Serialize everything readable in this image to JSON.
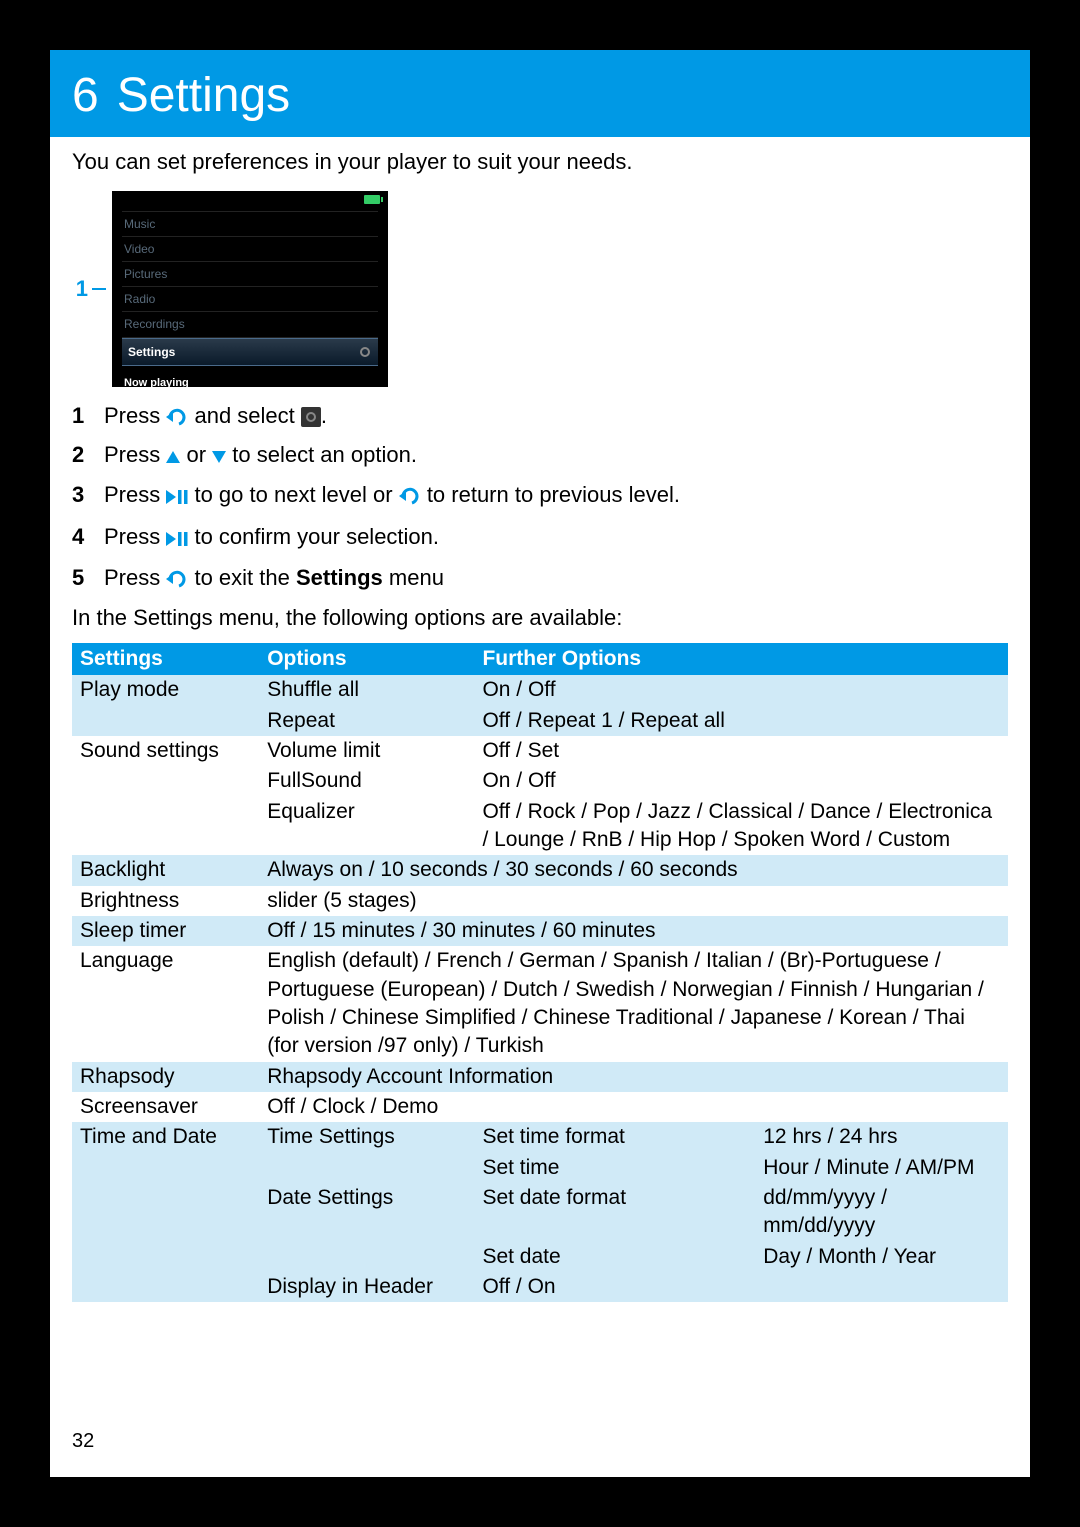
{
  "banner": {
    "num": "6",
    "title": "Settings"
  },
  "intro": "You can set preferences in your player to suit your needs.",
  "marker": "1",
  "device_menu": {
    "items": [
      "Music",
      "Video",
      "Pictures",
      "Radio",
      "Recordings"
    ],
    "selected": "Settings",
    "now_playing": "Now playing"
  },
  "steps": {
    "s1a": "Press ",
    "s1b": " and select ",
    "s1c": ".",
    "s2a": "Press ",
    "s2b": " or ",
    "s2c": " to select an option.",
    "s3a": "Press ",
    "s3b": " to go to next level or ",
    "s3c": " to return to previous level.",
    "s4a": "Press ",
    "s4b": " to confirm your selection.",
    "s5a": "Press ",
    "s5b": " to exit the ",
    "s5bold": "Settings",
    "s5c": " menu"
  },
  "outro": "In the Settings menu, the following options are available:",
  "table_headers": {
    "c1": "Settings",
    "c2": "Options",
    "c3": "Further Options",
    "c4": ""
  },
  "rows": {
    "r1": {
      "c1": "Play mode",
      "c2": "Shuffle all",
      "c3": "On / Off"
    },
    "r2": {
      "c1": "",
      "c2": "Repeat",
      "c3": "Off / Repeat 1 / Repeat all"
    },
    "r3": {
      "c1": "Sound settings",
      "c2": "Volume limit",
      "c3": "Off / Set"
    },
    "r4": {
      "c1": "",
      "c2": "FullSound",
      "c3": "On / Off"
    },
    "r5": {
      "c1": "",
      "c2": "Equalizer",
      "c3": "Off / Rock / Pop / Jazz / Classical / Dance / Electronica / Lounge / RnB / Hip Hop / Spoken Word / Custom"
    },
    "r6": {
      "c1": "Backlight",
      "c2": "Always on / 10 seconds / 30 seconds / 60 seconds"
    },
    "r7": {
      "c1": "Brightness",
      "c2": "slider (5 stages)"
    },
    "r8": {
      "c1": "Sleep timer",
      "c2": "Off / 15 minutes / 30 minutes / 60 minutes"
    },
    "r9": {
      "c1": "Language",
      "c2": "English (default) / French / German / Spanish / Italian / (Br)-Portuguese / Portuguese (European) / Dutch / Swedish / Norwegian / Finnish / Hungarian / Polish / Chinese Simplified / Chinese Traditional / Japanese / Korean / Thai (for version /97 only) / Turkish"
    },
    "r10": {
      "c1": "Rhapsody",
      "c2": "Rhapsody Account Information"
    },
    "r11": {
      "c1": "Screensaver",
      "c2": "Off / Clock / Demo"
    },
    "r12": {
      "c1": "Time and Date",
      "c2": "Time Settings",
      "c3": "Set time format",
      "c4": "12 hrs / 24 hrs"
    },
    "r13": {
      "c1": "",
      "c2": "",
      "c3": "Set time",
      "c4": "Hour / Minute / AM/PM"
    },
    "r14": {
      "c1": "",
      "c2": "Date Settings",
      "c3": "Set date format",
      "c4": "dd/mm/yyyy / mm/dd/yyyy"
    },
    "r15": {
      "c1": "",
      "c2": "",
      "c3": "Set date",
      "c4": "Day / Month / Year"
    },
    "r16": {
      "c1": "",
      "c2": "Display in Header",
      "c3": "Off / On",
      "c4": ""
    }
  },
  "page_number": "32"
}
